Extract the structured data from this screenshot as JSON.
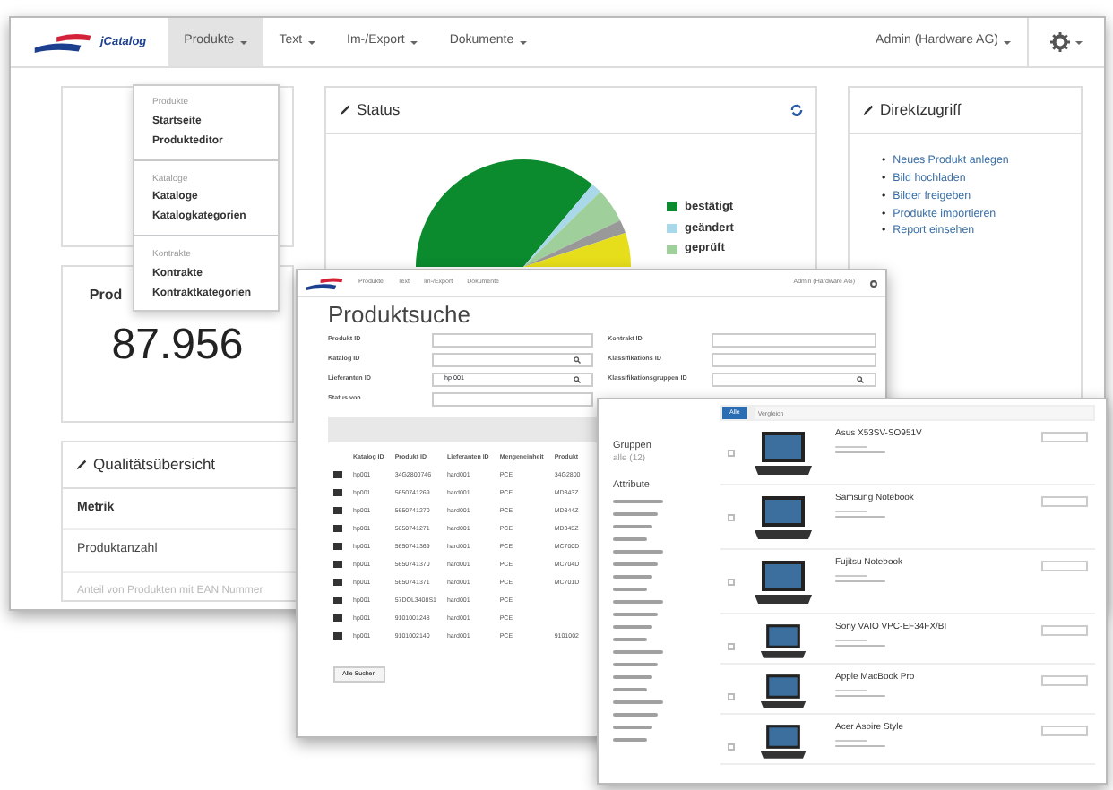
{
  "main_window": {
    "logo": "jCatalog",
    "menus": [
      {
        "label": "Produkte",
        "selected": true
      },
      {
        "label": "Text",
        "selected": false
      },
      {
        "label": "Im-/Export",
        "selected": false
      },
      {
        "label": "Dokumente",
        "selected": false
      }
    ],
    "user": "Admin (Hardware AG)",
    "dropdown": [
      {
        "header": "Produkte",
        "items": [
          "Startseite",
          "Produkteditor"
        ]
      },
      {
        "header": "Kataloge",
        "items": [
          "Kataloge",
          "Katalogkategorien"
        ]
      },
      {
        "header": "Kontrakte",
        "items": [
          "Kontrakte",
          "Kontraktkategorien"
        ]
      }
    ],
    "count_card": {
      "title": "Prod",
      "value": "87.956"
    },
    "quality_card": {
      "title": "Qualitätsübersicht",
      "rows": [
        {
          "text": "Metrik",
          "kind": "header"
        },
        {
          "text": "Produktanzahl",
          "kind": "row"
        },
        {
          "text": "Anteil von Produkten mit EAN Nummer",
          "kind": "faded"
        }
      ]
    },
    "status_card": {
      "title": "Status",
      "legend": [
        {
          "label": "bestätigt",
          "color": "#0b8a2e"
        },
        {
          "label": "geändert",
          "color": "#a8d8ea"
        },
        {
          "label": "geprüft",
          "color": "#9fcf9a"
        }
      ]
    },
    "direct_card": {
      "title": "Direktzugriff",
      "bullet": "•",
      "links": [
        "Neues Produkt anlegen",
        "Bild hochladen",
        "Bilder freigeben",
        "Produkte importieren",
        "Report einsehen"
      ]
    }
  },
  "search_window": {
    "menus": [
      "Produkte",
      "Text",
      "Im-/Export",
      "Dokumente"
    ],
    "user": "Admin (Hardware AG)",
    "title": "Produktsuche",
    "fields": [
      {
        "label": "Produkt ID",
        "lookup": false
      },
      {
        "label": "Kontrakt ID",
        "lookup": false
      },
      {
        "label": "Katalog ID",
        "lookup": true
      },
      {
        "label": "Klassifikations ID",
        "lookup": false
      },
      {
        "label": "Lieferanten ID",
        "value": "hp 001",
        "lookup": true
      },
      {
        "label": "Klassifikationsgruppen ID",
        "lookup": true
      },
      {
        "label": "Status von",
        "lookup": false
      }
    ],
    "columns": [
      "Katalog ID",
      "Produkt ID",
      "Lieferanten ID",
      "Mengeneinheit",
      "Produkt"
    ],
    "rows": [
      [
        "hp001",
        "34G2800746",
        "hard001",
        "PCE",
        "34G2800"
      ],
      [
        "hp001",
        "5650741269",
        "hard001",
        "PCE",
        "MD343Z"
      ],
      [
        "hp001",
        "5650741270",
        "hard001",
        "PCE",
        "MD344Z"
      ],
      [
        "hp001",
        "5650741271",
        "hard001",
        "PCE",
        "MD345Z"
      ],
      [
        "hp001",
        "5650741369",
        "hard001",
        "PCE",
        "MC700D"
      ],
      [
        "hp001",
        "5650741370",
        "hard001",
        "PCE",
        "MC704D"
      ],
      [
        "hp001",
        "5650741371",
        "hard001",
        "PCE",
        "MC701D"
      ],
      [
        "hp001",
        "57DOL3408S1",
        "hard001",
        "PCE",
        ""
      ],
      [
        "hp001",
        "9101001248",
        "hard001",
        "PCE",
        ""
      ],
      [
        "hp001",
        "9101002140",
        "hard001",
        "PCE",
        "9101002"
      ]
    ],
    "button": "Alle Suchen"
  },
  "catalog_window": {
    "toolbar_button": "Alle",
    "search_placeholder": "Vergleich",
    "groups_title": "Gruppen",
    "groups_all": "alle (12)",
    "attributes_title": "Attribute",
    "products": [
      {
        "name": "Asus X53SV-SO951V",
        "checked": false
      },
      {
        "name": "Samsung Notebook",
        "checked": false
      },
      {
        "name": "Fujitsu Notebook",
        "checked": false
      },
      {
        "name": "Sony VAIO VPC-EF34FX/BI",
        "checked": false
      },
      {
        "name": "Apple MacBook Pro",
        "checked": false
      },
      {
        "name": "Acer Aspire Style",
        "checked": false
      }
    ]
  }
}
